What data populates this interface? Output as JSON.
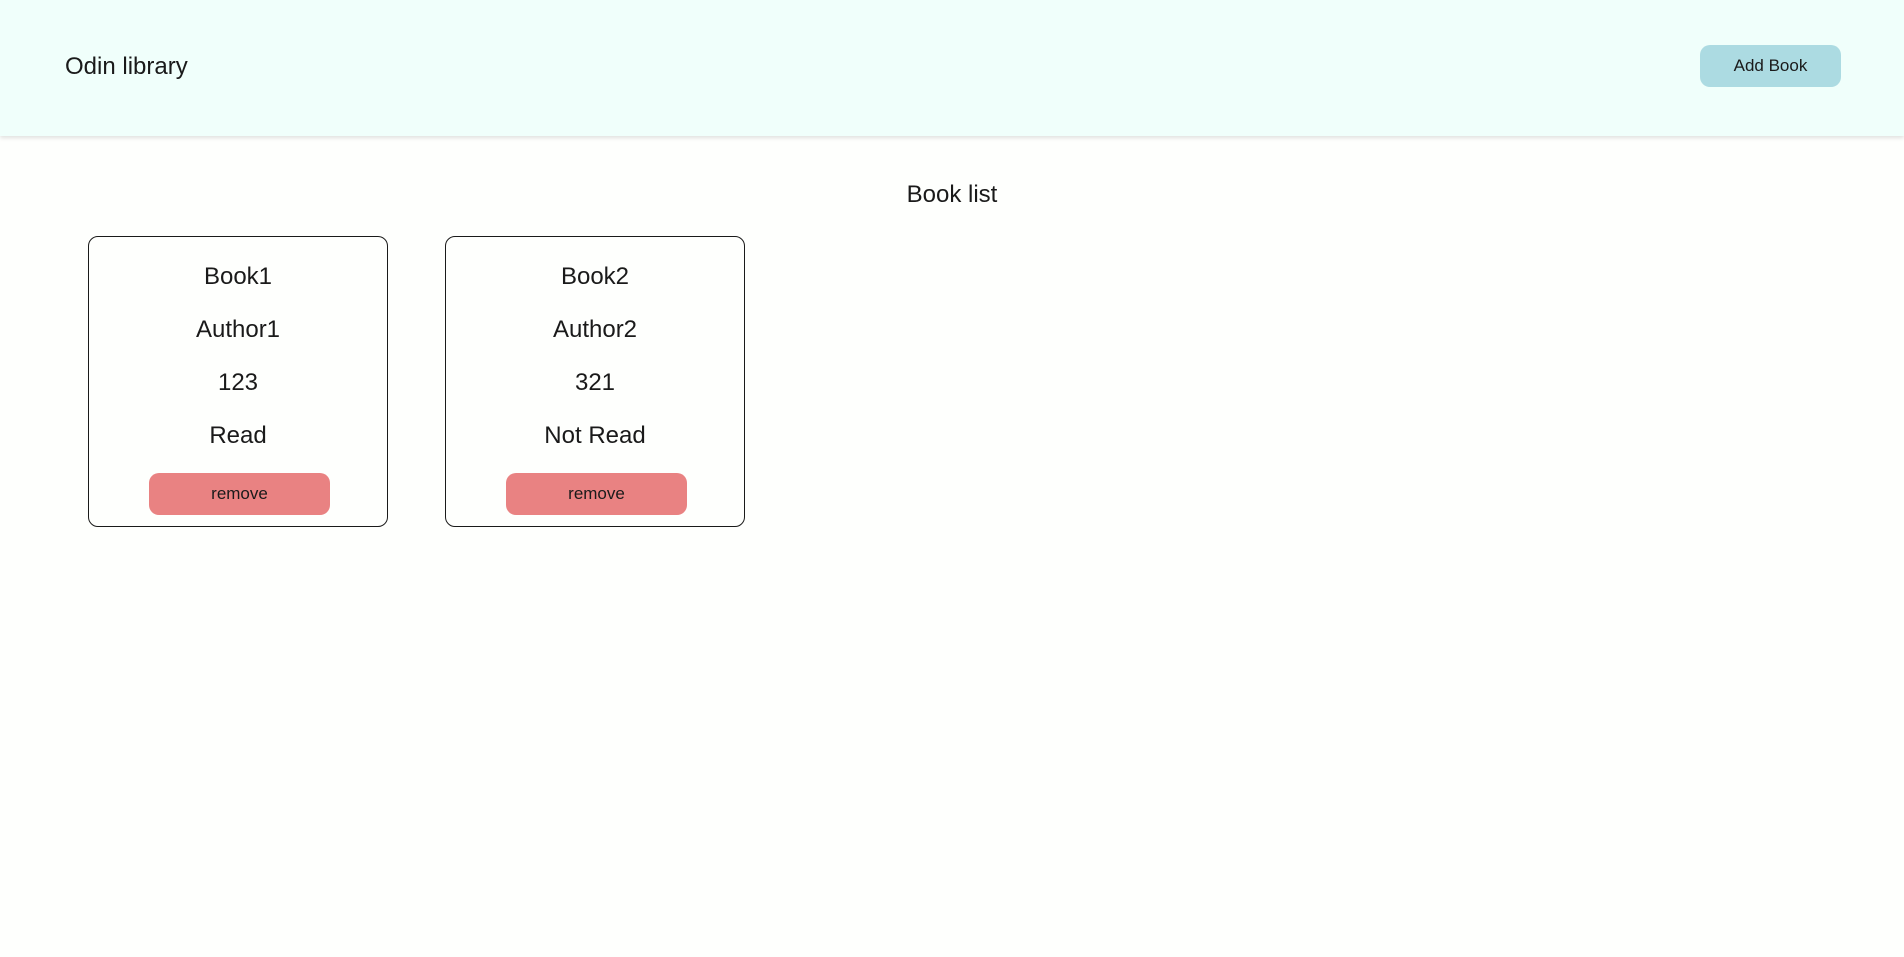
{
  "header": {
    "app_title": "Odin library",
    "add_book_label": "Add Book"
  },
  "main": {
    "title": "Book list",
    "books": [
      {
        "title": "Book1",
        "author": "Author1",
        "pages": "123",
        "status": "Read",
        "remove_label": "remove"
      },
      {
        "title": "Book2",
        "author": "Author2",
        "pages": "321",
        "status": "Not Read",
        "remove_label": "remove"
      }
    ]
  },
  "colors": {
    "header_background": "#f0fffb",
    "add_button": "#acdbe2",
    "remove_button": "#e98282",
    "page_background": "#fefffd"
  }
}
